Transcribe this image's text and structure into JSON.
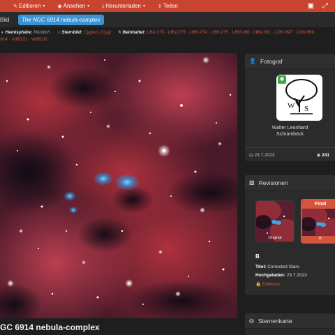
{
  "topbar": {
    "items": [
      {
        "label": "Bild",
        "icon": "image-icon"
      },
      {
        "label": "Editieren",
        "icon": "pencil-icon"
      },
      {
        "label": "Ansehen",
        "icon": "eye-icon"
      },
      {
        "label": "Herunterladen",
        "icon": "download-icon"
      },
      {
        "label": "Teilen",
        "icon": "share-icon"
      }
    ],
    "menu_labels": [
      "Editieren",
      "Ansehen",
      "Herunterladen",
      "Teilen"
    ],
    "right_icons": [
      "bookmark-icon",
      "fullscreen-icon"
    ]
  },
  "subbar": {
    "left_label": "Bild",
    "title_pill": "The NGC 6914 nebula-complex"
  },
  "meta": {
    "hemisphere_label": "Hemisphäre:",
    "hemisphere_value": "Nördlich",
    "constellation_label": "Sternbild:",
    "constellation_value": "Cygnus (Cyg)",
    "contains_label": "Beinhaltet:",
    "objects_row1": [
      "LBN 270",
      "LBN 273",
      "LBN 274",
      "LBN 275",
      "LBN 280",
      "LBN 281",
      "LDN 897",
      "LDN 899"
    ],
    "objects_row2": [
      "914",
      "VdB131",
      "VdB132"
    ]
  },
  "image_title": "GC 6914 nebula-complex",
  "photographer": {
    "heading": "Fotograf",
    "name_line1": "Walter Leonhard",
    "name_line2": "Schramböck",
    "avatar_text": "WS",
    "date": "23.7.2023",
    "views": "241"
  },
  "revisions": {
    "heading": "Revisionen",
    "original_label": "Original",
    "final_top": "Final",
    "final_label": "B",
    "letter": "B",
    "title_label": "Titel:",
    "title_value": "Corrected Stars",
    "uploaded_label": "Hochgeladen:",
    "uploaded_value": "23.7.2023",
    "edit_label": "Editieren"
  },
  "starmap": {
    "heading": "Sternenkarte"
  },
  "colors": {
    "accent": "#c8442f",
    "link": "#d4553d",
    "pill": "#3a93d2",
    "badge": "#3ea64e"
  }
}
